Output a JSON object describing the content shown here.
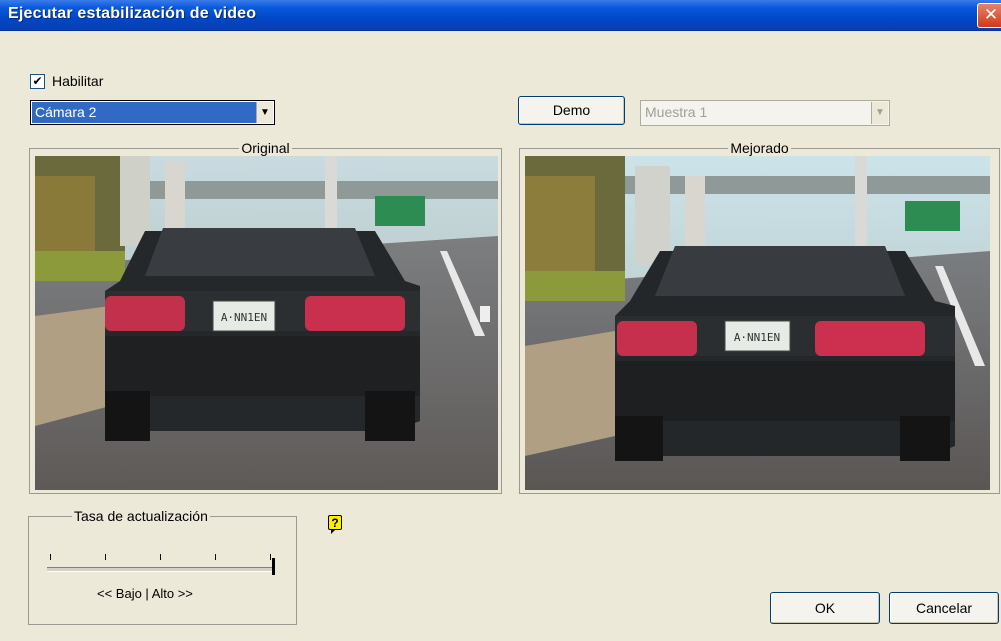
{
  "window": {
    "title": "Ejecutar estabilización de video",
    "close_label": "✕"
  },
  "enable": {
    "label": "Habilitar",
    "checked": true,
    "check_mark": "✔"
  },
  "camera_select": {
    "value": "Cámara 2",
    "arrow": "▼"
  },
  "demo_button": {
    "label": "Demo"
  },
  "sample_select": {
    "value": "Muestra 1",
    "enabled": false,
    "arrow": "▼"
  },
  "panels": {
    "original": {
      "label": "Original",
      "plate": "A·NN1EN"
    },
    "enhanced": {
      "label": "Mejorado",
      "plate": "A·NN1EN"
    }
  },
  "refresh_rate": {
    "label": "Tasa de actualización",
    "scale_label": "<< Bajo | Alto >>",
    "level": 1.0
  },
  "help_icon": {
    "glyph": "?"
  },
  "buttons": {
    "ok": "OK",
    "cancel": "Cancelar"
  },
  "colors": {
    "title_bar": "#0a5adc",
    "selection": "#316ac5",
    "dialog_bg": "#ece9d8"
  }
}
